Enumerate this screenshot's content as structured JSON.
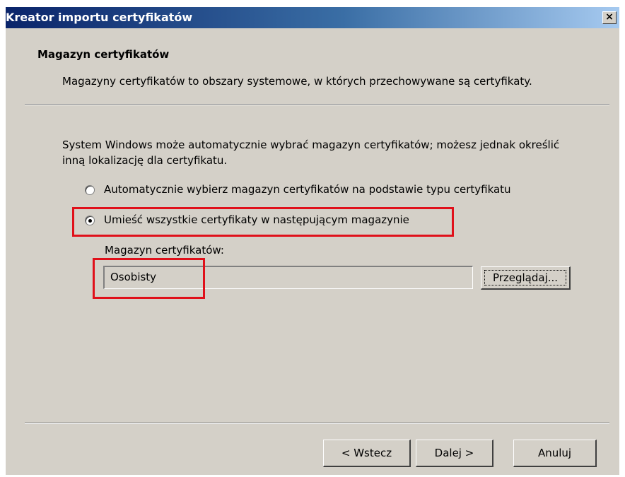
{
  "window": {
    "title": "Kreator importu certyfikatów",
    "close_glyph": "×"
  },
  "header": {
    "title": "Magazyn certyfikatów",
    "subtitle": "Magazyny certyfikatów to obszary systemowe, w których przechowywane są certyfikaty."
  },
  "body": {
    "intro": "System Windows może automatycznie wybrać magazyn certyfikatów; możesz jednak określić inną lokalizację dla certyfikatu.",
    "options": [
      {
        "label": "Automatycznie wybierz magazyn certyfikatów na podstawie typu certyfikatu",
        "selected": false
      },
      {
        "label": "Umieść wszystkie certyfikaty w następującym magazynie",
        "selected": true
      }
    ],
    "store_label": "Magazyn certyfikatów:",
    "store_value": "Osobisty",
    "browse_label": "Przeglądaj..."
  },
  "footer": {
    "back_label": "< Wstecz",
    "next_label": "Dalej >",
    "cancel_label": "Anuluj"
  },
  "highlight_color": "#e0101a",
  "icons": [
    "close-icon",
    "radio-icon"
  ]
}
